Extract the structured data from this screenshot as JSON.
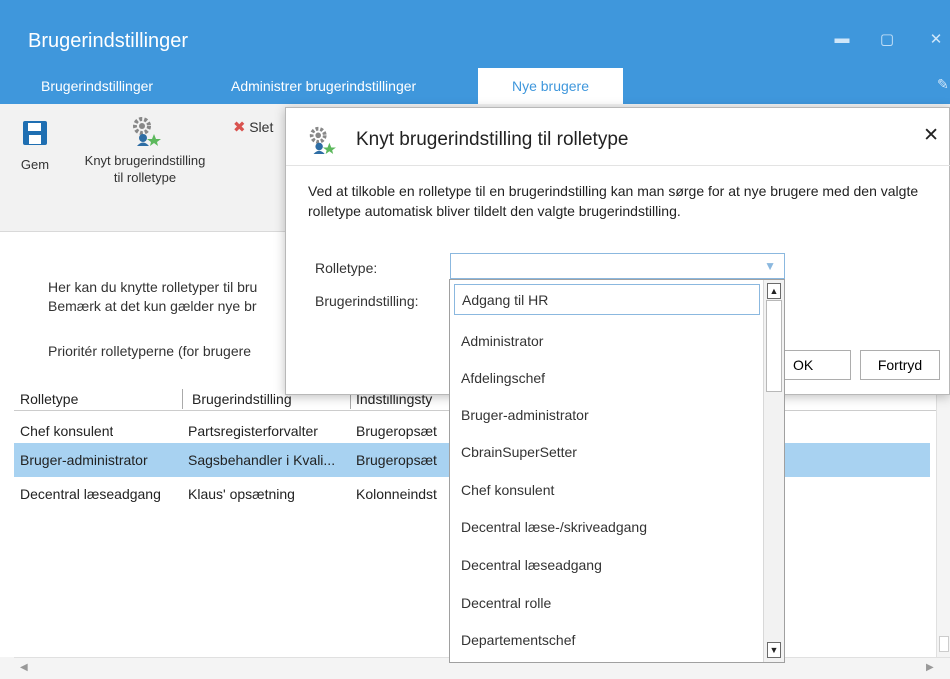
{
  "window": {
    "title": "Brugerindstillinger",
    "minimize": "▬",
    "maximize": "▢",
    "close": "✕"
  },
  "tabs": [
    {
      "label": "Brugerindstillinger"
    },
    {
      "label": "Administrer brugerindstillinger"
    },
    {
      "label": "Nye brugere"
    }
  ],
  "ribbon": {
    "save_label": "Gem",
    "link_label_1": "Knyt brugerindstilling",
    "link_label_2": "til rolletype",
    "delete_label": "Slet"
  },
  "main": {
    "intro_line1": "Her kan du knytte rolletyper til bru",
    "intro_line2": "Bemærk at det kun gælder nye br",
    "priority": "Prioritér rolletyperne (for brugere"
  },
  "grid": {
    "columns": [
      "Rolletype",
      "Brugerindstilling",
      "Indstillingsty"
    ],
    "rows": [
      {
        "rolletype": "Chef konsulent",
        "setting": "Partsregisterforvalter",
        "type": "Brugeropsæt"
      },
      {
        "rolletype": "Bruger-administrator",
        "setting": "Sagsbehandler i Kvali...",
        "type": "Brugeropsæt"
      },
      {
        "rolletype": "Decentral læseadgang",
        "setting": "Klaus' opsætning",
        "type": "Kolonneindst"
      }
    ]
  },
  "dialog": {
    "title": "Knyt brugerindstilling til rolletype",
    "close": "✕",
    "description": "Ved at tilkoble en rolletype til en brugerindstilling kan man sørge for at nye brugere med den valgte rolletype automatisk bliver tildelt den valgte brugerindstilling.",
    "rolletype_label": "Rolletype:",
    "setting_label": "Brugerindstilling:",
    "ok": "OK",
    "cancel": "Fortryd"
  },
  "dropdown": {
    "items": [
      "Adgang til HR",
      "Administrator",
      "Afdelingschef",
      "Bruger-administrator",
      "CbrainSuperSetter",
      "Chef konsulent",
      "Decentral læse-/skriveadgang",
      "Decentral læseadgang",
      "Decentral rolle",
      "Departementschef"
    ]
  },
  "colors": {
    "accent": "#3f97dc",
    "selection": "#a8d2f1",
    "delete_red": "#d9534f",
    "save_blue": "#1f6fb2"
  }
}
